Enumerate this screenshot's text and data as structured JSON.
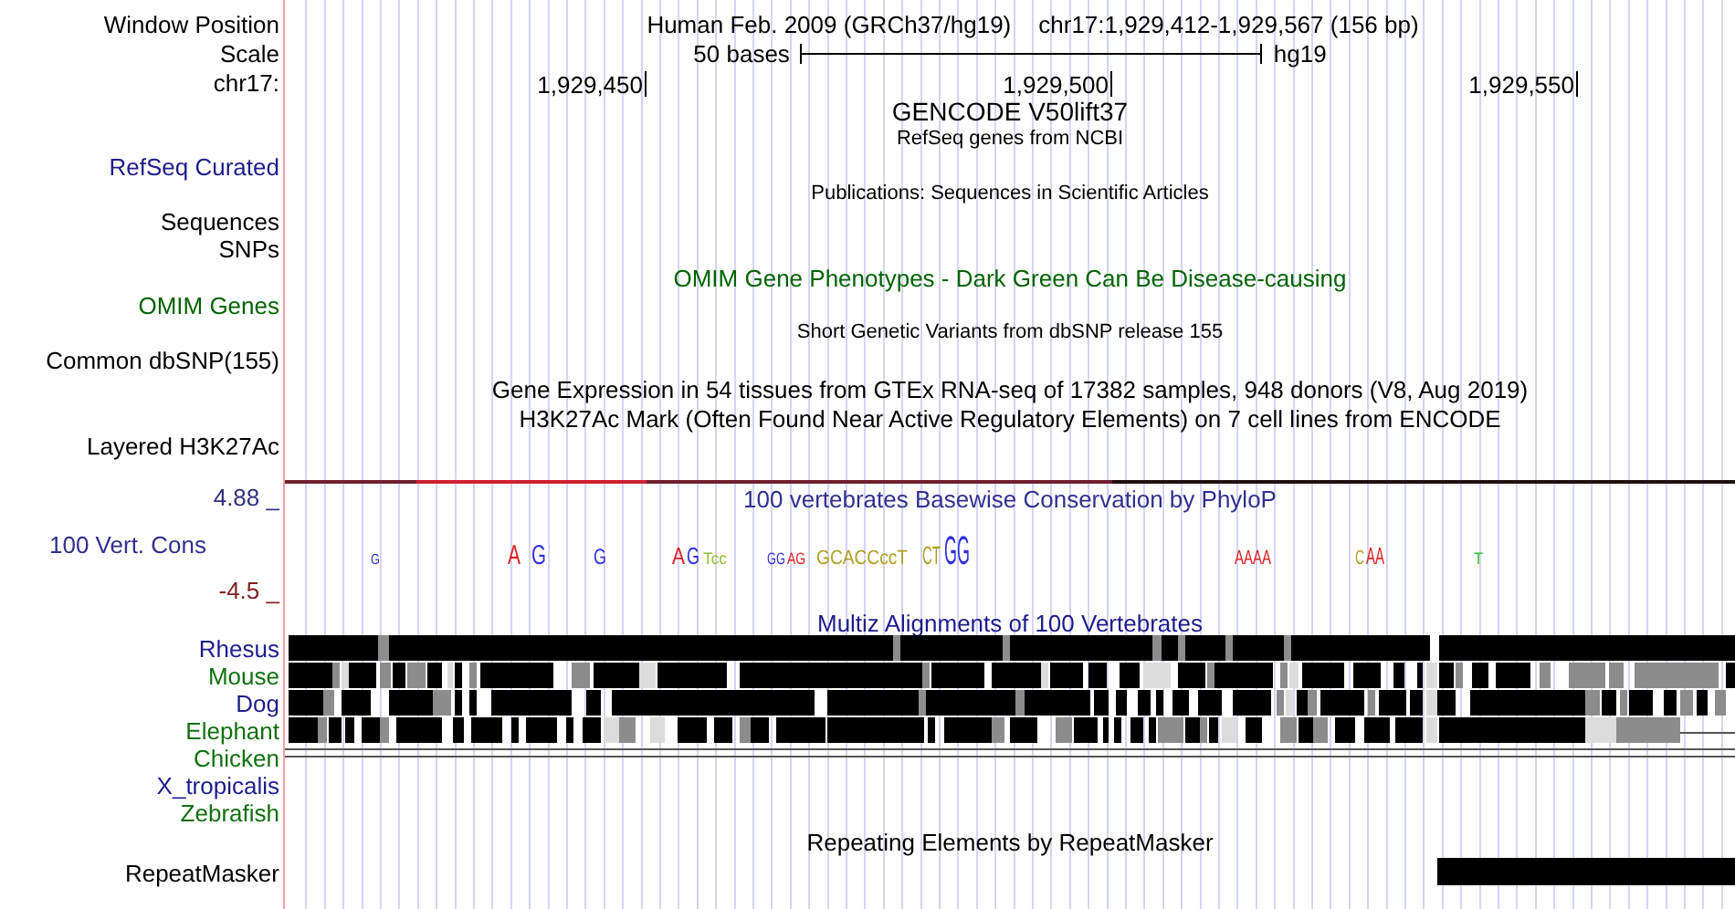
{
  "position": {
    "label": "Window Position",
    "assembly": "Human Feb. 2009 (GRCh37/hg19)",
    "range": "chr17:1,929,412-1,929,567 (156 bp)"
  },
  "scale": {
    "label": "Scale",
    "length": "50 bases",
    "assembly": "hg19"
  },
  "ruler": {
    "label": "chr17:",
    "ticks": [
      "1,929,450",
      "1,929,500",
      "1,929,550"
    ]
  },
  "tracks": [
    {
      "kind": "heading",
      "text": "GENCODE V50lift37"
    },
    {
      "kind": "caption",
      "text": "RefSeq genes from NCBI"
    },
    {
      "kind": "label",
      "text": "RefSeq Curated",
      "color": "#1c1c8c"
    },
    {
      "kind": "caption",
      "text": "Publications: Sequences in Scientific Articles"
    },
    {
      "kind": "label",
      "text": "Sequences"
    },
    {
      "kind": "label",
      "text": "SNPs"
    },
    {
      "kind": "title",
      "text": "OMIM Gene Phenotypes - Dark Green Can Be Disease-causing",
      "color": "#006400"
    },
    {
      "kind": "label",
      "text": "OMIM Genes",
      "color": "#006400"
    },
    {
      "kind": "caption",
      "text": "Short Genetic Variants from dbSNP release 155"
    },
    {
      "kind": "label",
      "text": "Common dbSNP(155)"
    },
    {
      "kind": "title",
      "text": "Gene Expression in 54 tissues from GTEx RNA-seq of 17382 samples, 948 donors (V8, Aug 2019)"
    },
    {
      "kind": "title",
      "text": "H3K27Ac Mark (Often Found Near Active Regulatory Elements) on 7 cell lines from ENCODE"
    },
    {
      "kind": "label",
      "text": "Layered H3K27Ac"
    }
  ],
  "conservation": {
    "title": "100 vertebrates Basewise Conservation by PhyloP",
    "label": "100 Vert. Cons",
    "ymax": "4.88 _",
    "ymin": "-4.5 _",
    "logo": [
      {
        "text": "G",
        "color": "#3030e0"
      },
      {
        "text": "A",
        "color": "#e02020"
      },
      {
        "text": "G",
        "color": "#3030e0"
      },
      {
        "text": "G",
        "color": "#3030e0"
      },
      {
        "text": "A",
        "color": "#e02020"
      },
      {
        "text": "G",
        "color": "#3030e0"
      },
      {
        "text": "Tcc",
        "color": "#8fc030"
      },
      {
        "text": "GG",
        "color": "#3030e0"
      },
      {
        "text": "AG",
        "color": "#e02020"
      },
      {
        "text": "GCACCccT",
        "color": "#b0a020"
      },
      {
        "text": "CT",
        "color": "#b0a020"
      },
      {
        "text": "GG",
        "color": "#3030e0"
      },
      {
        "text": "AAAA",
        "color": "#e02020"
      },
      {
        "text": "C",
        "color": "#b0a020"
      },
      {
        "text": "AA",
        "color": "#e02020"
      },
      {
        "text": "T",
        "color": "#30c030"
      }
    ]
  },
  "multiz": {
    "title": "Multiz Alignments of 100 Vertebrates",
    "species": [
      {
        "name": "Rhesus",
        "color": "#1c1c8c"
      },
      {
        "name": "Mouse",
        "color": "#107010"
      },
      {
        "name": "Dog",
        "color": "#1c1c8c"
      },
      {
        "name": "Elephant",
        "color": "#107010"
      },
      {
        "name": "Chicken",
        "color": "#107010"
      },
      {
        "name": "X_tropicalis",
        "color": "#1c1c8c"
      },
      {
        "name": "Zebrafish",
        "color": "#107010"
      }
    ]
  },
  "repeatmasker": {
    "title": "Repeating Elements by RepeatMasker",
    "label": "RepeatMasker"
  }
}
